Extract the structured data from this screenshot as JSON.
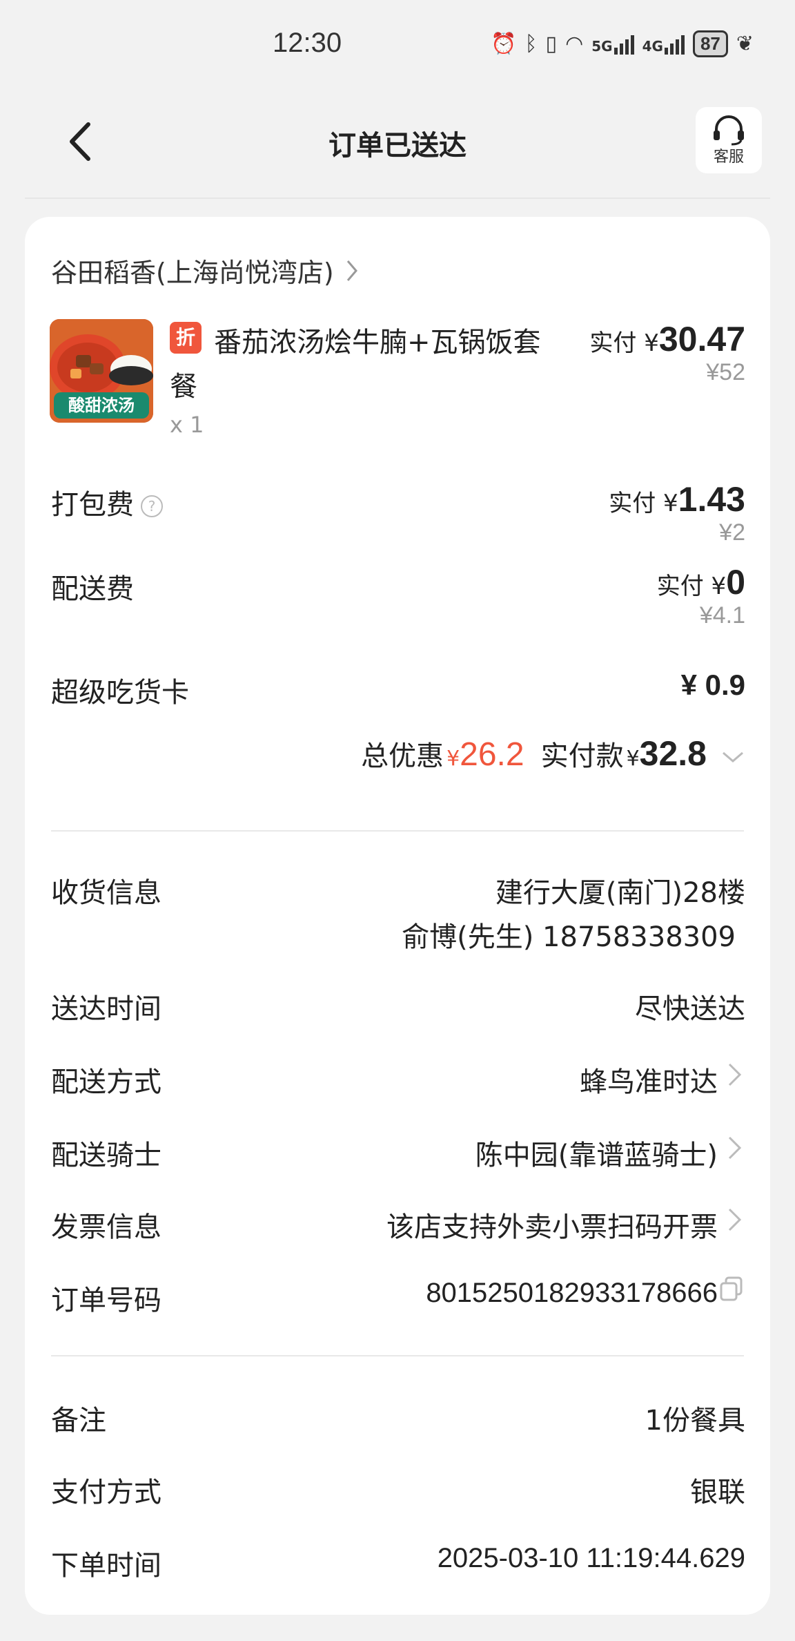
{
  "status": {
    "time": "12:30",
    "battery": "87",
    "sig1": "5G",
    "sig2": "4G"
  },
  "header": {
    "title": "订单已送达",
    "service_label": "客服"
  },
  "store": {
    "name": "谷田稻香(上海尚悦湾店)"
  },
  "item": {
    "badge": "折",
    "name": "番茄浓汤烩牛腩+瓦锅饭套餐",
    "image_tag": "酸甜浓汤",
    "qty": "x 1",
    "paid_prefix": "实付 ¥",
    "paid": "30.47",
    "original": "¥52"
  },
  "packing": {
    "label": "打包费",
    "help": "?",
    "paid_prefix": "实付 ¥",
    "paid": "1.43",
    "original": "¥2"
  },
  "delivery_fee": {
    "label": "配送费",
    "paid_prefix": "实付 ¥",
    "paid": "0",
    "original": "¥4.1"
  },
  "super_card": {
    "label": "超级吃货卡",
    "value": "¥ 0.9"
  },
  "totals": {
    "discount_label": "总优惠",
    "discount_currency": "¥",
    "discount": "26.2",
    "paid_label": "实付款",
    "paid_currency": "¥",
    "paid": "32.8"
  },
  "info": {
    "address_label": "收货信息",
    "address": "建行大厦(南门)28楼",
    "contact": "俞博(先生) 18758338309",
    "time_label": "送达时间",
    "time": "尽快送达",
    "method_label": "配送方式",
    "method": "蜂鸟准时达",
    "rider_label": "配送骑士",
    "rider": "陈中园(靠谱蓝骑士)",
    "invoice_label": "发票信息",
    "invoice": "该店支持外卖小票扫码开票",
    "order_label": "订单号码",
    "order_no": "8015250182933178666"
  },
  "extra": {
    "remark_label": "备注",
    "remark": "1份餐具",
    "pay_label": "支付方式",
    "pay": "银联",
    "order_time_label": "下单时间",
    "order_time": "2025-03-10 11:19:44.629"
  }
}
